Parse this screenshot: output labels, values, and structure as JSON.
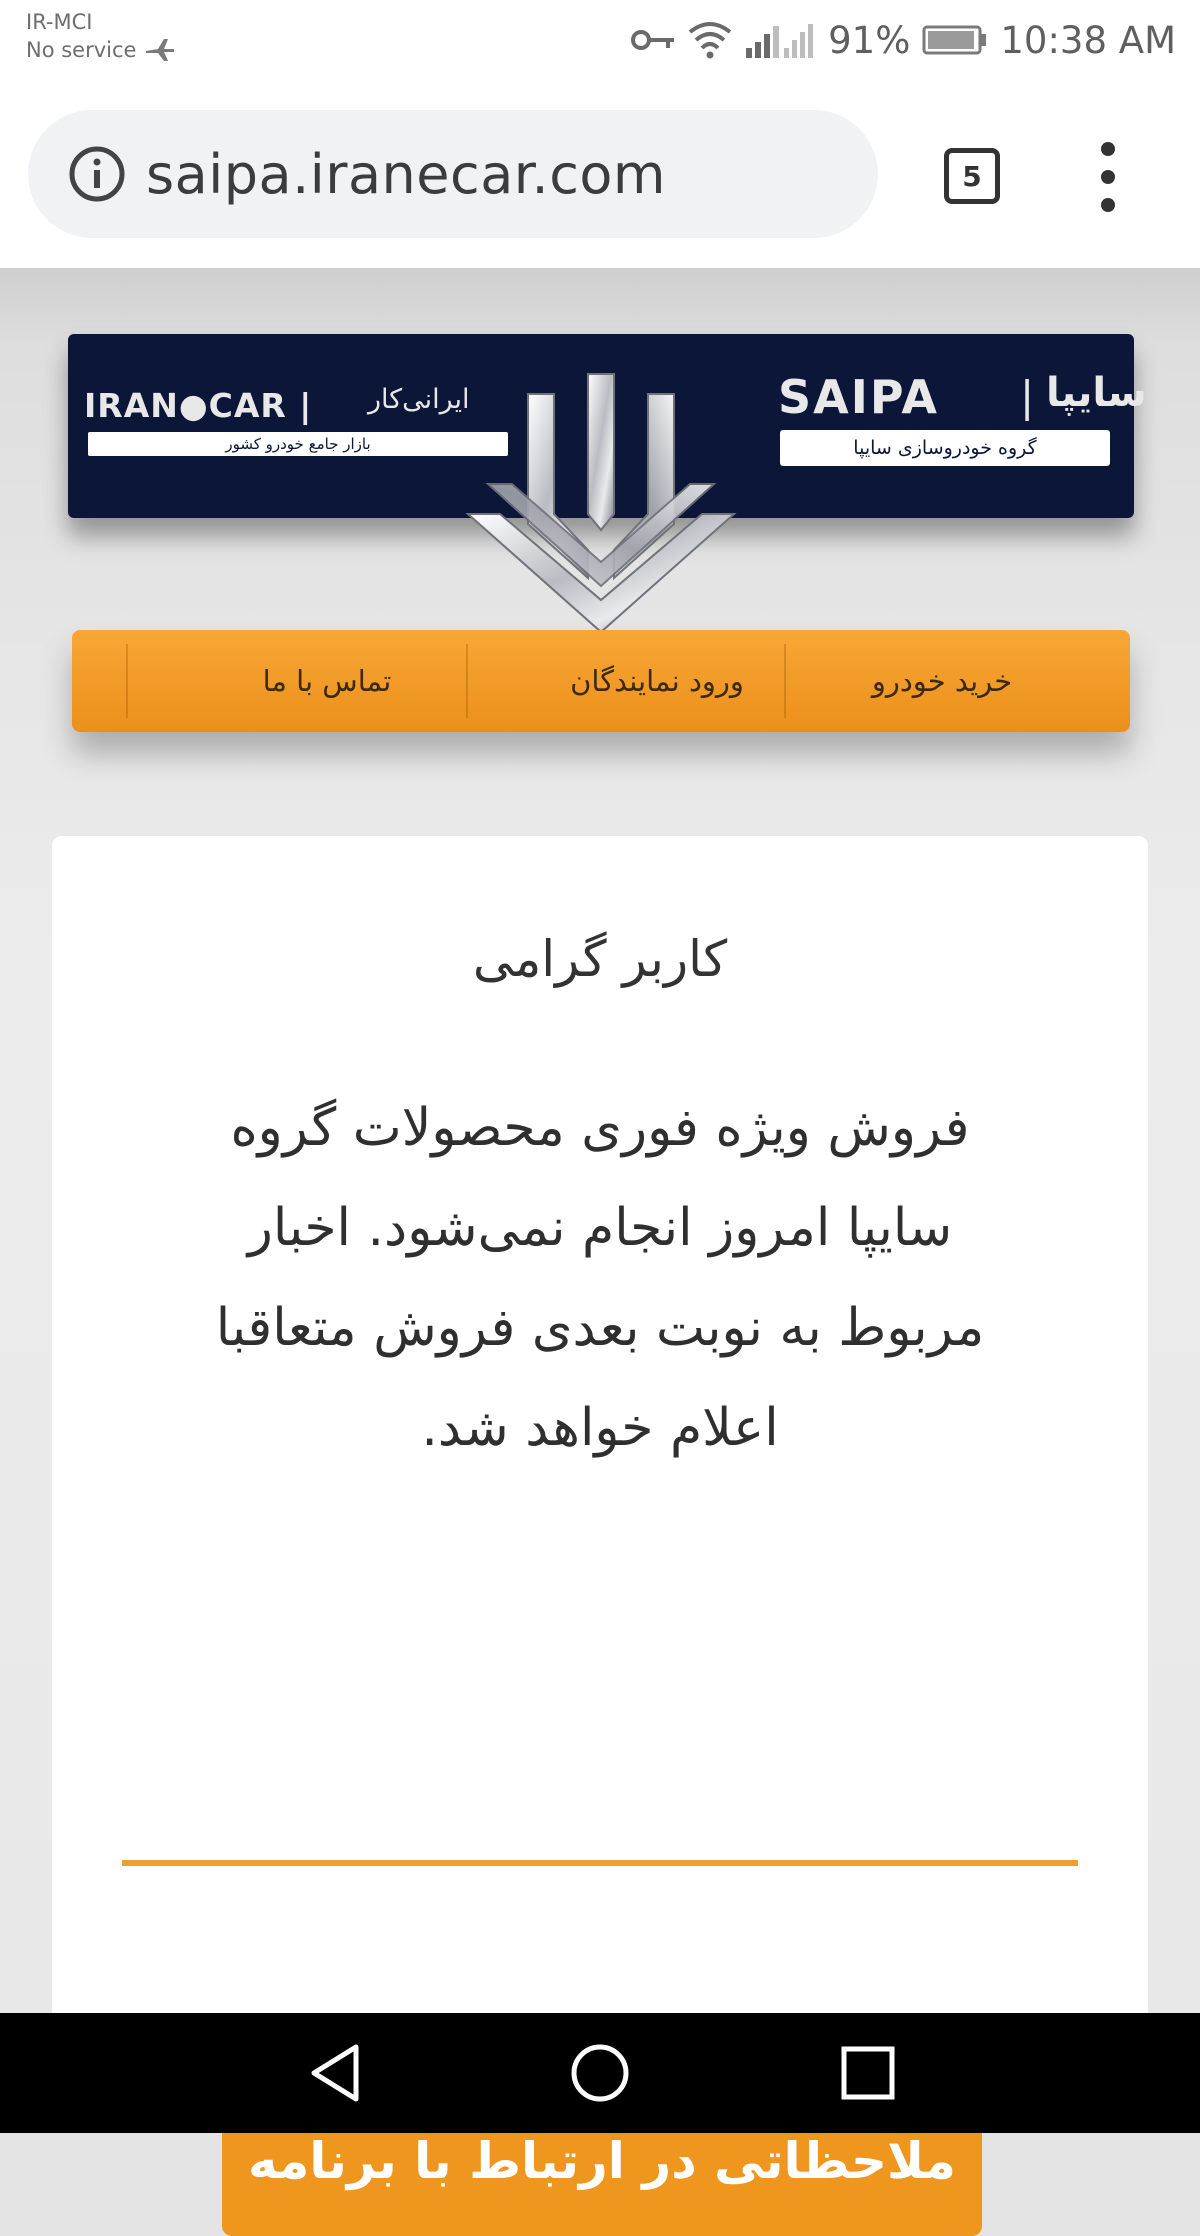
{
  "status_bar": {
    "carrier": "IR-MCI",
    "service": "No service",
    "battery": "91%",
    "time": "10:38 AM"
  },
  "browser": {
    "url": "saipa.iranecar.com",
    "tab_count": "5"
  },
  "banner": {
    "iranecar_logo": "IRAN●CAR  |",
    "iranecar_fa": "ایرانی‌کار",
    "iranecar_sub": "بازار جامع خودرو کشور",
    "saipa_logo": "SAIPA",
    "saipa_sep": "|",
    "saipa_fa": "سایپا",
    "saipa_sub": "گروه خودروسازی سایپا"
  },
  "nav": {
    "buy_car": "خرید خودرو",
    "dealer_login": "ورود نمایندگان",
    "contact_us": "تماس با ما"
  },
  "card": {
    "title": "کاربر گرامی",
    "message": "فروش ویژه فوری محصولات گروه سایپا امروز انجام نمی‌شود. اخبار مربوط به نوبت بعدی فروش متعاقبا اعلام خواهد شد.",
    "feedback_button": "ملاحظاتی در ارتباط با برنامه"
  },
  "colors": {
    "banner_bg": "#0c1638",
    "accent_orange": "#ef961f"
  },
  "icons": [
    "airplane-icon",
    "key-icon",
    "wifi-icon",
    "signal-icon",
    "battery-icon",
    "info-icon",
    "tabs-icon",
    "overflow-menu-icon",
    "saipa-emblem",
    "back-icon",
    "home-icon",
    "recents-icon"
  ]
}
